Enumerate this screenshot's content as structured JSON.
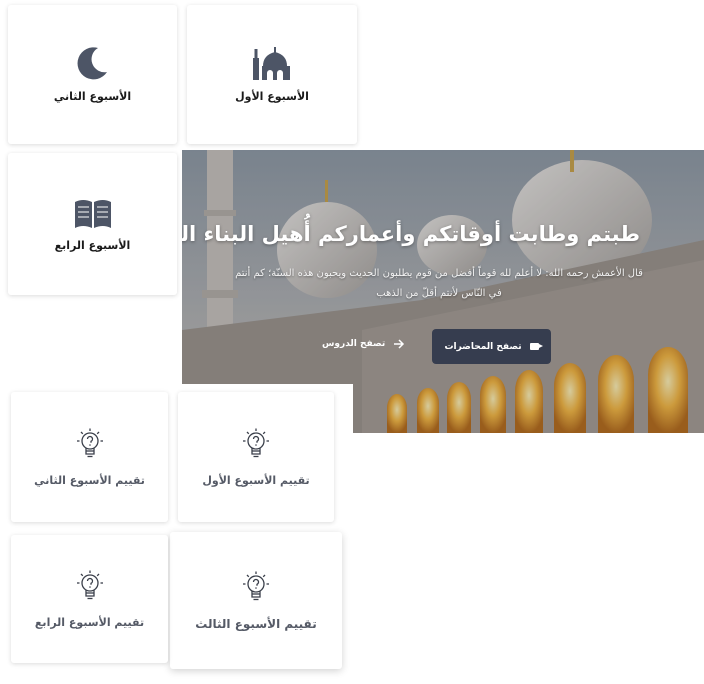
{
  "weeks": {
    "week1": "الأسبوع الأول",
    "week2": "الأسبوع الثاني",
    "week4": "الأسبوع الرابع"
  },
  "hero": {
    "title": "طبتم وطابت أوقاتكم وأعماركم أُهيل البناء المُبارك",
    "quote": "قال الأعمش رحمه الله: لا أعلم لله قوماً أفضل من قوم يطلبون الحديث ويحبون هذه السنّة؛ كم أنتم في النّاس لأنتم أقلّ من الذهب",
    "btn_lectures": "تصفح المحاضرات",
    "link_lessons": "تصفح الدروس"
  },
  "evals": {
    "eval1": "تقييم الأسبوع الأول",
    "eval2": "تقييم الأسبوع الثاني",
    "eval3": "تقييم الأسبوع الثالث",
    "eval4": "تقييم الأسبوع الرابع"
  },
  "colors": {
    "icon": "#4d5566",
    "button": "#363d4f"
  }
}
